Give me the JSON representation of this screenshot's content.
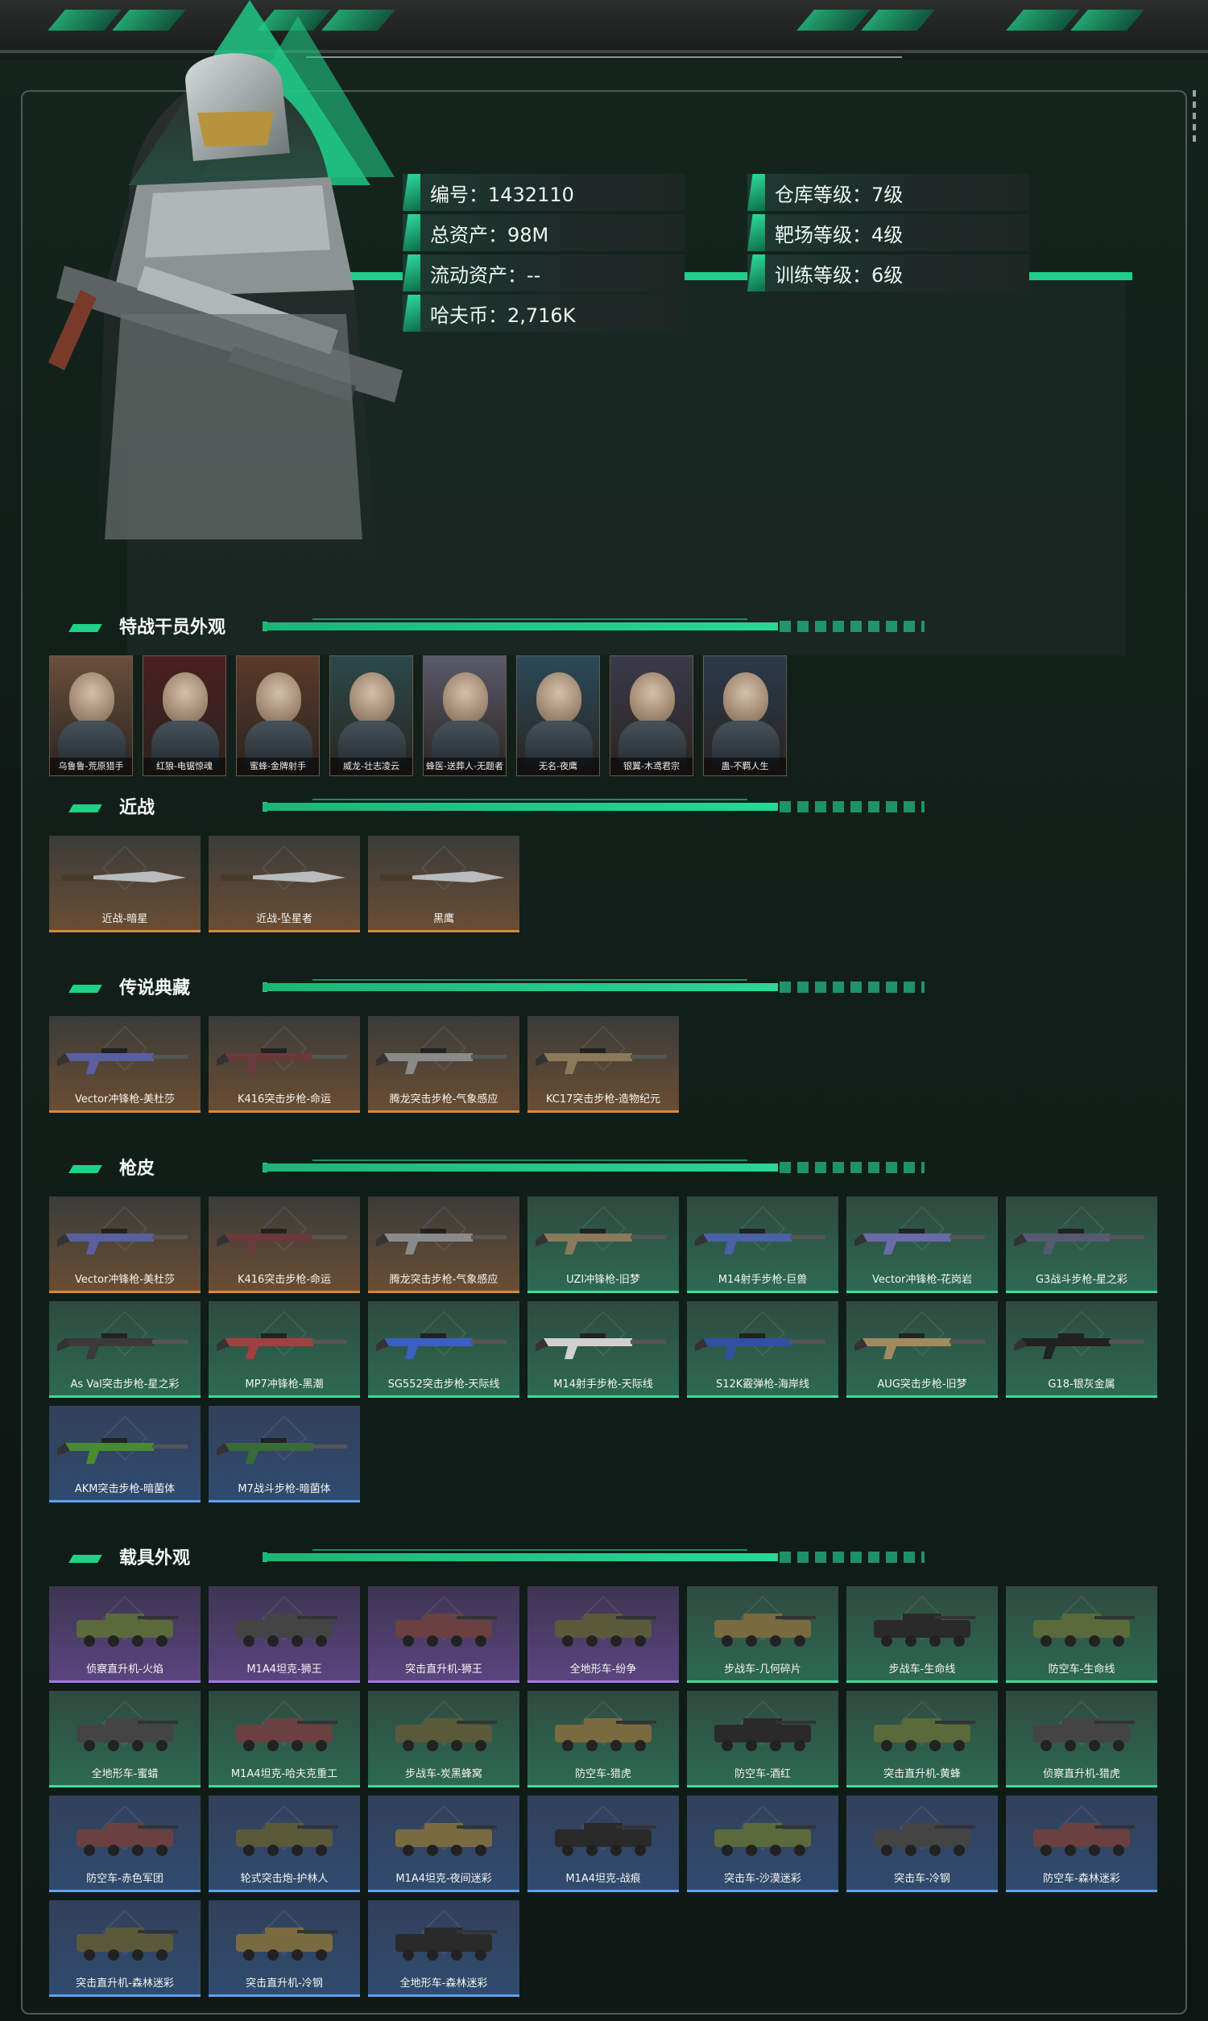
{
  "profile": {
    "stats": [
      {
        "label": "编号：1432110"
      },
      {
        "label": "仓库等级：7级"
      },
      {
        "label": "总资产：98M"
      },
      {
        "label": "靶场等级：4级"
      },
      {
        "label": "流动资产：--"
      },
      {
        "label": "训练等级：6级"
      },
      {
        "label": "哈夫币：2,716K"
      }
    ]
  },
  "sections": {
    "operators": {
      "title": "特战干员外观",
      "items": [
        "乌鲁鲁-荒原猎手",
        "红狼-电锯惊魂",
        "蜜蜂-金牌射手",
        "威龙-壮志凌云",
        "蜂医-送葬人-无题者",
        "无名-夜鹰",
        "银翼-木鸢君宗",
        "蛊-不羁人生"
      ]
    },
    "melee": {
      "title": "近战",
      "items": [
        "近战-暗星",
        "近战-坠星者",
        "黑鹰"
      ]
    },
    "legend": {
      "title": "传说典藏",
      "items": [
        "Vector冲锋枪-美杜莎",
        "K416突击步枪-命运",
        "腾龙突击步枪-气象感应",
        "KC17突击步枪-造物纪元"
      ]
    },
    "skins": {
      "title": "枪皮",
      "items": [
        {
          "name": "Vector冲锋枪-美杜莎",
          "tier": "gold"
        },
        {
          "name": "K416突击步枪-命运",
          "tier": "gold"
        },
        {
          "name": "腾龙突击步枪-气象感应",
          "tier": "gold"
        },
        {
          "name": "UZI冲锋枪-旧梦",
          "tier": "green"
        },
        {
          "name": "M14射手步枪-巨兽",
          "tier": "green"
        },
        {
          "name": "Vector冲锋枪-花岗岩",
          "tier": "green"
        },
        {
          "name": "G3战斗步枪-星之彩",
          "tier": "green"
        },
        {
          "name": "As Val突击步枪-星之彩",
          "tier": "green"
        },
        {
          "name": "MP7冲锋枪-黑潮",
          "tier": "green"
        },
        {
          "name": "SG552突击步枪-天际线",
          "tier": "green"
        },
        {
          "name": "M14射手步枪-天际线",
          "tier": "green"
        },
        {
          "name": "S12K霰弹枪-海岸线",
          "tier": "green"
        },
        {
          "name": "AUG突击步枪-旧梦",
          "tier": "green"
        },
        {
          "name": "G18-银灰金属",
          "tier": "green"
        },
        {
          "name": "AKM突击步枪-暗菌体",
          "tier": "blue"
        },
        {
          "name": "M7战斗步枪-暗菌体",
          "tier": "blue"
        }
      ]
    },
    "vehicles": {
      "title": "载具外观",
      "items": [
        {
          "name": "侦察直升机-火焰",
          "tier": "purple"
        },
        {
          "name": "M1A4坦克-狮王",
          "tier": "purple"
        },
        {
          "name": "突击直升机-狮王",
          "tier": "purple"
        },
        {
          "name": "全地形车-纷争",
          "tier": "purple"
        },
        {
          "name": "步战车-几何碎片",
          "tier": "green"
        },
        {
          "name": "步战车-生命线",
          "tier": "green"
        },
        {
          "name": "防空车-生命线",
          "tier": "green"
        },
        {
          "name": "全地形车-蜜蜡",
          "tier": "green"
        },
        {
          "name": "M1A4坦克-哈夫克重工",
          "tier": "green"
        },
        {
          "name": "步战车-炭黑蜂窝",
          "tier": "green"
        },
        {
          "name": "防空车-猎虎",
          "tier": "green"
        },
        {
          "name": "防空车-酒红",
          "tier": "green"
        },
        {
          "name": "突击直升机-黄蜂",
          "tier": "green"
        },
        {
          "name": "侦察直升机-猎虎",
          "tier": "green"
        },
        {
          "name": "防空车-赤色军团",
          "tier": "blue"
        },
        {
          "name": "轮式突击炮-护林人",
          "tier": "blue"
        },
        {
          "name": "M1A4坦克-夜间迷彩",
          "tier": "blue"
        },
        {
          "name": "M1A4坦克-战痕",
          "tier": "blue"
        },
        {
          "name": "突击车-沙漠迷彩",
          "tier": "blue"
        },
        {
          "name": "突击车-冷钢",
          "tier": "blue"
        },
        {
          "name": "防空车-森林迷彩",
          "tier": "blue"
        },
        {
          "name": "突击直升机-森林迷彩",
          "tier": "blue"
        },
        {
          "name": "突击直升机-冷钢",
          "tier": "blue"
        },
        {
          "name": "全地形车-森林迷彩",
          "tier": "blue"
        }
      ]
    }
  }
}
